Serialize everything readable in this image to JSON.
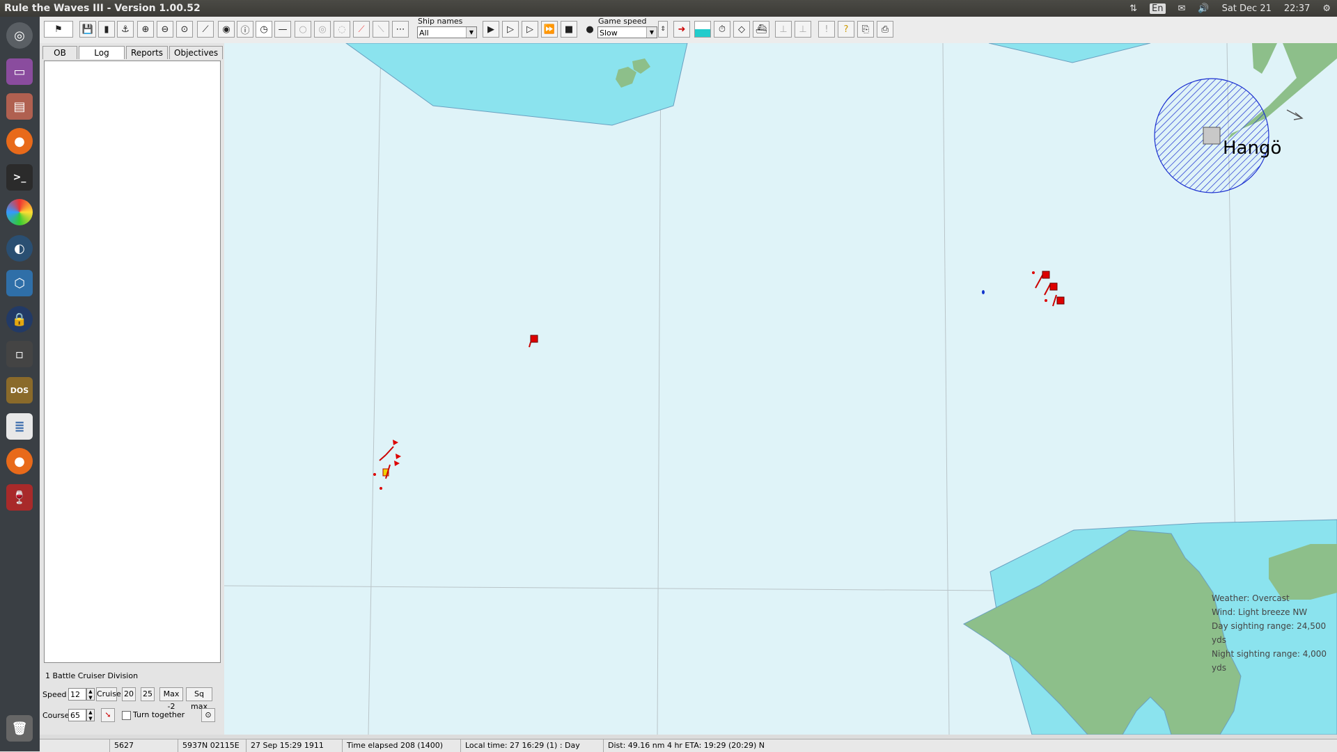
{
  "window": {
    "title": "Rule the Waves III - Version 1.00.52"
  },
  "system_tray": {
    "lang": "En",
    "date": "Sat Dec 21",
    "time": "22:37"
  },
  "launcher": {
    "items": [
      "dash-icon",
      "files-icon",
      "file-manager-icon",
      "firefox-icon",
      "terminal-icon",
      "color-app-icon",
      "steam-icon",
      "virtualbox-icon",
      "lock-icon",
      "window-icon",
      "dosbox-icon",
      "text-editor-icon",
      "firefox-icon",
      "wine-icon",
      "trash-icon"
    ]
  },
  "toolbar": {
    "ship_names_label": "Ship names",
    "ship_names_value": "All",
    "game_speed_label": "Game speed",
    "game_speed_value": "Slow"
  },
  "left_panel": {
    "tabs": [
      "OB",
      "Log",
      "Reports",
      "Objectives"
    ],
    "active_tab": "Log",
    "division": "1 Battle Cruiser Division",
    "speed_label": "Speed",
    "speed_value": "12",
    "speed_buttons": [
      "Cruise",
      "20",
      "25",
      "Max -2",
      "Sq max"
    ],
    "course_label": "Course",
    "course_value": "65",
    "turn_together_label": "Turn together"
  },
  "map": {
    "place_name": "Hangö",
    "weather": [
      "Weather: Overcast",
      "Wind: Light breeze  NW",
      "Day sighting range: 24,500 yds",
      "Night sighting range: 4,000 yds"
    ],
    "colors": {
      "sea": "#dff3f8",
      "shallow": "#8be3ee",
      "land": "#8dbf8a",
      "enemy": "#dd0000",
      "friendly": "#1133cc"
    }
  },
  "status_bar": {
    "field1": "5627",
    "position": "5937N 02115E",
    "datetime": "27 Sep 15:29 1911",
    "elapsed": "Time elapsed 208 (1400)",
    "local_time": "Local time: 27 16:29 (1) : Day",
    "distance": "Dist: 49.16 nm 4 hr ETA: 19:29 (20:29) N"
  }
}
